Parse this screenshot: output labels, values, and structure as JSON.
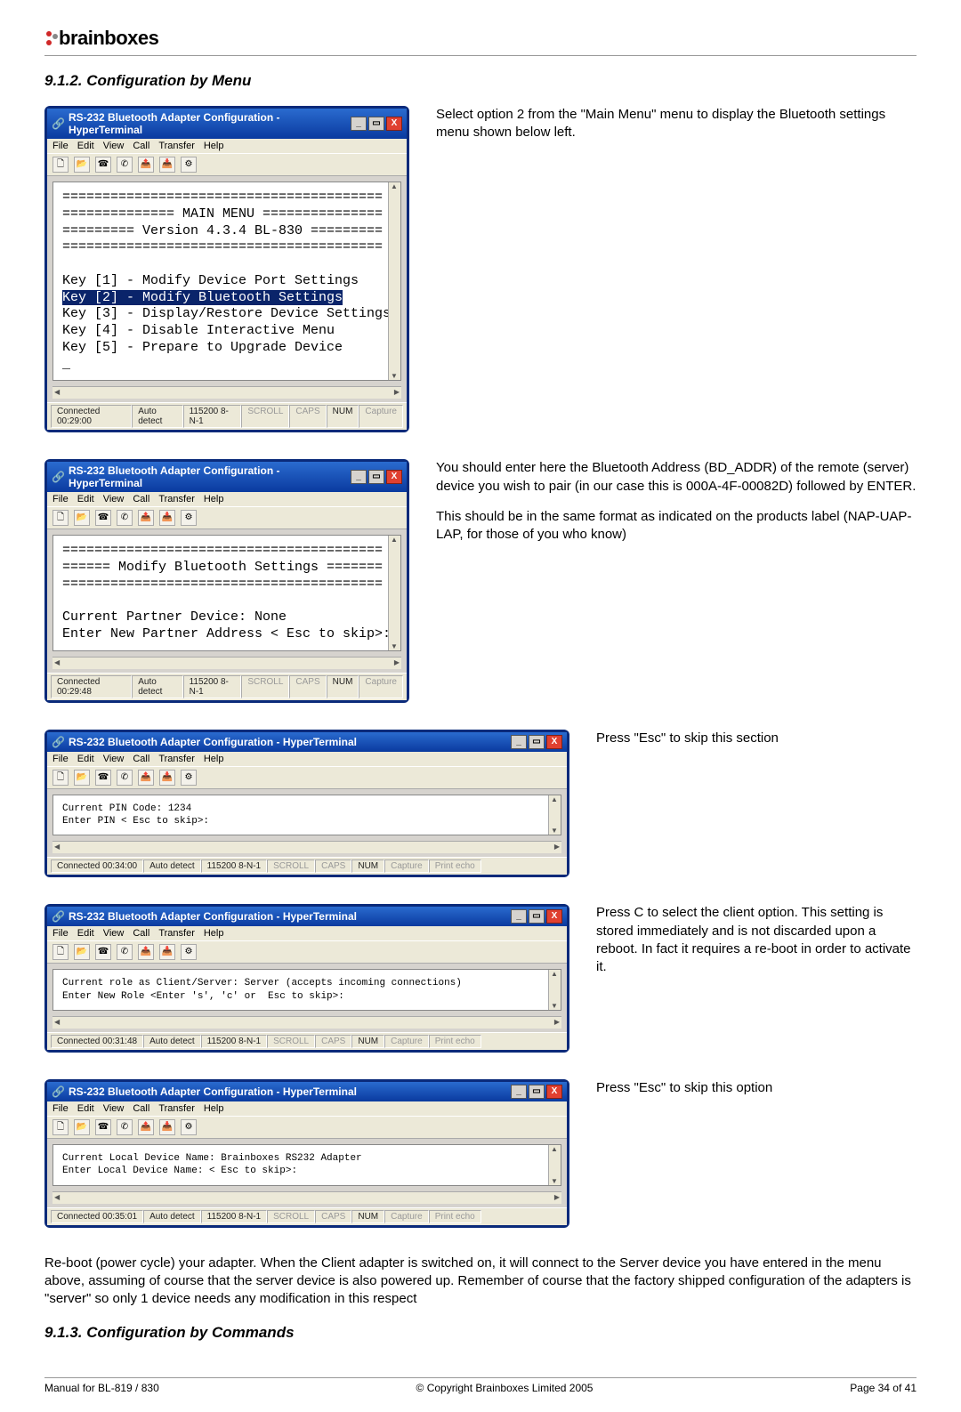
{
  "brand": "brainboxes",
  "section_912": "9.1.2. Configuration by Menu",
  "section_913": "9.1.3. Configuration by Commands",
  "window_title": "RS-232 Bluetooth Adapter Configuration - HyperTerminal",
  "menubar": {
    "file": "File",
    "edit": "Edit",
    "view": "View",
    "call": "Call",
    "transfer": "Transfer",
    "help": "Help"
  },
  "win_controls": {
    "min": "_",
    "max": "▭",
    "close": "X"
  },
  "status": {
    "t1": "Connected 00:29:00",
    "t2": "Connected 00:29:48",
    "t3": "Connected 00:34:00",
    "t4": "Connected 00:31:48",
    "t5": "Connected 00:35:01",
    "auto": "Auto detect",
    "baud": "115200 8-N-1",
    "scroll": "SCROLL",
    "caps": "CAPS",
    "num": "NUM",
    "capture": "Capture",
    "print": "Print echo"
  },
  "term1_body": "========================================\n============== MAIN MENU ===============\n========= Version 4.3.4 BL-830 =========\n========================================\n\nKey [1] - Modify Device Port Settings\n",
  "term1_highlight": "Key [2] - Modify Bluetooth Settings",
  "term1_rest": "Key [3] - Display/Restore Device Settings\nKey [4] - Disable Interactive Menu\nKey [5] - Prepare to Upgrade Device\n_",
  "desc1": "Select option 2 from the \"Main Menu\" menu to display the Bluetooth settings menu shown below left.",
  "term2": "========================================\n====== Modify Bluetooth Settings =======\n========================================\n\nCurrent Partner Device: None\nEnter New Partner Address < Esc to skip>: _",
  "desc2a": "You should enter here the Bluetooth Address (BD_ADDR) of the remote (server) device you wish to pair (in our case this is 000A-4F-00082D) followed by ENTER.",
  "desc2b": "This should be in the same format as indicated on the products label (NAP-UAP-LAP, for those of you who know)",
  "term3": "Current PIN Code: 1234\nEnter PIN < Esc to skip>:",
  "desc3": "Press \"Esc\" to skip this section",
  "term4": "Current role as Client/Server: Server (accepts incoming connections)\nEnter New Role <Enter 's', 'c' or  Esc to skip>:",
  "desc4": "Press C to select the client option. This setting is stored immediately and is not discarded upon a reboot. In fact it requires a re-boot in order to activate it.",
  "term5": "Current Local Device Name: Brainboxes RS232 Adapter\nEnter Local Device Name: < Esc to skip>:",
  "desc5": "Press \"Esc\" to skip this option",
  "bottom": "Re-boot (power cycle) your adapter. When the Client adapter is switched on, it will connect to the Server device you have entered in the menu above, assuming of course that the server device is also powered up. Remember of course that the factory shipped configuration of the adapters is \"server\" so only 1 device needs any modification in this respect",
  "footer": {
    "left": "Manual for BL-819 / 830",
    "center": "© Copyright Brainboxes Limited 2005",
    "right": "Page 34 of 41"
  }
}
